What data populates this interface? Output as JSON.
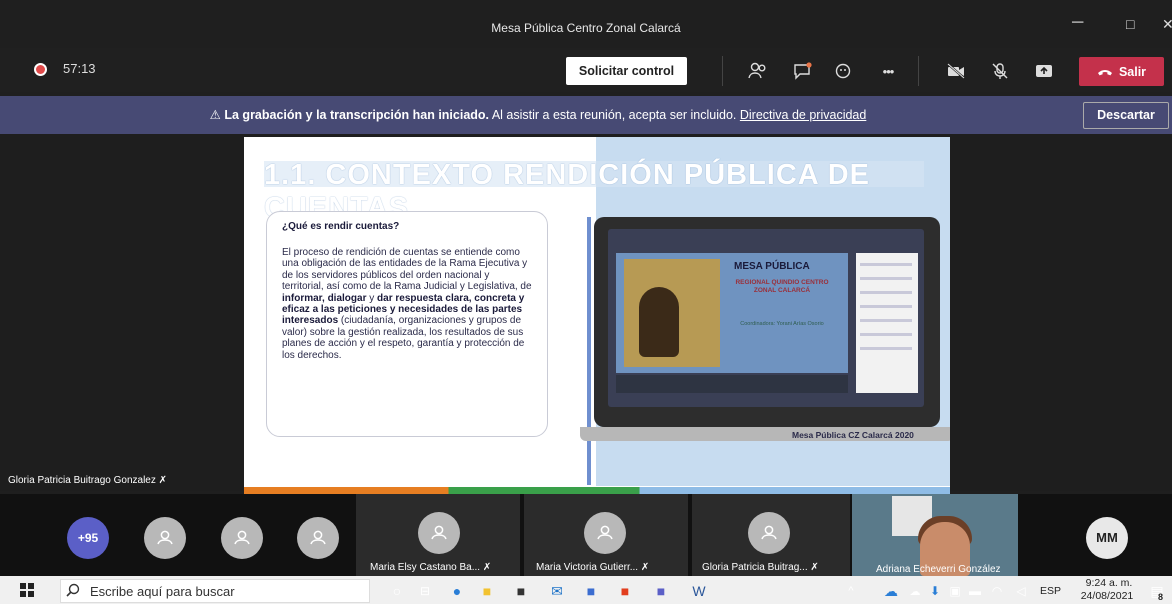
{
  "window": {
    "title": "Mesa Pública Centro Zonal Calarcá",
    "minimize": "─",
    "maximize": "□",
    "close": "✕"
  },
  "toolbar": {
    "timer": "57:13",
    "request_control": "Solicitar control",
    "leave": "Salir",
    "more": "•••",
    "icons": [
      "people-icon",
      "chat-icon",
      "reactions-icon",
      "more-icon",
      "camera-off-icon",
      "mic-off-icon",
      "share-icon",
      "phone-icon"
    ]
  },
  "banner": {
    "bold": "La grabación y la transcripción han iniciado.",
    "text": " Al asistir a esta reunión, acepta ser incluido. ",
    "link": "Directiva de privacidad",
    "dismiss": "Descartar"
  },
  "slide": {
    "title": "1.1. CONTEXTO RENDICIÓN PÚBLICA DE CUENTAS",
    "question": "¿Qué es rendir cuentas?",
    "para_1": "El proceso de rendición de cuentas se entiende como una obligación de las entidades de la Rama Ejecutiva y de los servidores públicos del orden nacional y territorial, así como de la Rama Judicial y Legislativa, de ",
    "bold_1": "informar, dialogar",
    "para_2": " y ",
    "bold_2": "dar respuesta clara, concreta y eficaz a las peticiones y necesidades de las partes interesados",
    "para_3": " (ciudadanía, organizaciones y grupos de valor) sobre la gestión realizada, los resultados de sus planes de acción y el respeto, garantía y protección de los derechos.",
    "photo_title": "MESA PÚBLICA",
    "photo_sub": "REGIONAL QUINDIO CENTRO ZONAL CALARCÁ",
    "photo_coord": "Coordinadora: Yorani Arías Osorio",
    "caption": "Mesa Pública CZ Calarcá 2020"
  },
  "speaker_name": "Gloria Patricia Buitrago Gonzalez",
  "participants": {
    "overflow": "+95",
    "tiles": [
      {
        "name": "Maria Elsy Castano Ba..."
      },
      {
        "name": "Maria Victoria Gutierr..."
      },
      {
        "name": "Gloria Patricia Buitrag..."
      }
    ],
    "video_name": "Adriana Echeverri González",
    "mm": "MM"
  },
  "taskbar": {
    "search_placeholder": "Escribe aquí para buscar",
    "lang": "ESP",
    "time": "9:24 a. m.",
    "date": "24/08/2021",
    "notif": "8"
  }
}
